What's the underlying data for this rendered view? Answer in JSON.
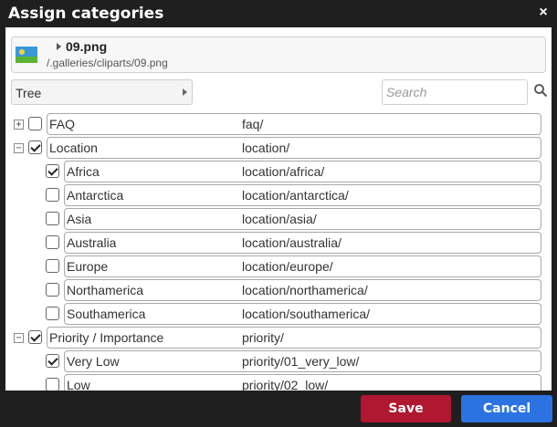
{
  "dialog": {
    "title": "Assign categories",
    "close_glyph": "×"
  },
  "file": {
    "name": "09.png",
    "path": "/.galleries/cliparts/09.png",
    "thumb_icon": "image-file-icon"
  },
  "view": {
    "selected": "Tree"
  },
  "search": {
    "placeholder": "Search",
    "value": ""
  },
  "tree": {
    "rows": [
      {
        "toggle": "+",
        "checked": false,
        "name": "FAQ",
        "slug": "faq/"
      },
      {
        "toggle": "−",
        "checked": true,
        "name": "Location",
        "slug": "location/"
      },
      {
        "toggle": "",
        "checked": true,
        "name": "Africa",
        "slug": "location/africa/"
      },
      {
        "toggle": "",
        "checked": false,
        "name": "Antarctica",
        "slug": "location/antarctica/"
      },
      {
        "toggle": "",
        "checked": false,
        "name": "Asia",
        "slug": "location/asia/"
      },
      {
        "toggle": "",
        "checked": false,
        "name": "Australia",
        "slug": "location/australia/"
      },
      {
        "toggle": "",
        "checked": false,
        "name": "Europe",
        "slug": "location/europe/"
      },
      {
        "toggle": "",
        "checked": false,
        "name": "Northamerica",
        "slug": "location/northamerica/"
      },
      {
        "toggle": "",
        "checked": false,
        "name": "Southamerica",
        "slug": "location/southamerica/"
      },
      {
        "toggle": "−",
        "checked": true,
        "name": "Priority / Importance",
        "slug": "priority/"
      },
      {
        "toggle": "",
        "checked": true,
        "name": "Very Low",
        "slug": "priority/01_very_low/"
      },
      {
        "toggle": "",
        "checked": false,
        "name": "Low",
        "slug": "priority/02_low/"
      }
    ]
  },
  "footer": {
    "save_label": "Save",
    "cancel_label": "Cancel"
  },
  "colors": {
    "save": "#b01730",
    "cancel": "#2b73e0",
    "titlebar": "#1f1f1f"
  }
}
